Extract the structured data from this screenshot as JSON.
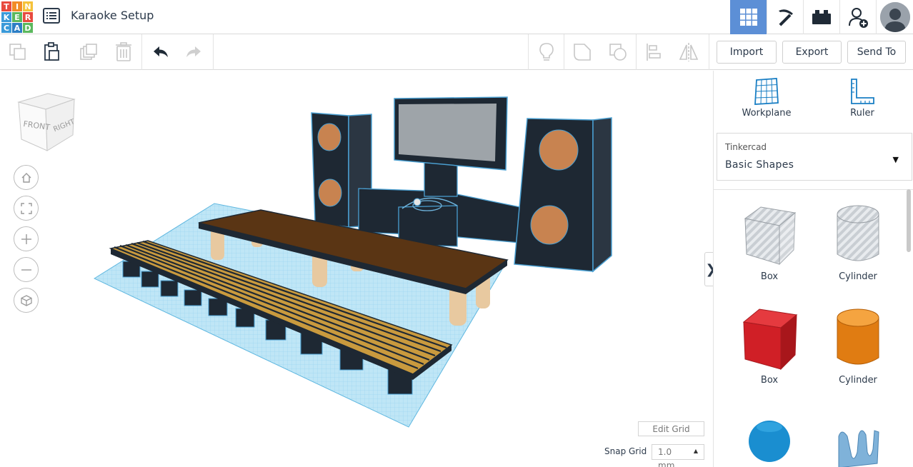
{
  "app": {
    "logo_letters": [
      "T",
      "I",
      "N",
      "K",
      "E",
      "R",
      "C",
      "A",
      "D"
    ],
    "logo_colors": [
      "#e84a3e",
      "#f28c28",
      "#f5c23a",
      "#3a9ad9",
      "#5bb85d",
      "#e84a3e",
      "#3a9ad9",
      "#2d7ec4",
      "#5bb85d"
    ],
    "title": "Karaoke Setup"
  },
  "topbar": {
    "icons": [
      "3d-design-grid-icon",
      "pickaxe-icon",
      "brick-icon",
      "add-user-icon"
    ],
    "active_color": "#5c8fd6"
  },
  "toolbar": {
    "import_label": "Import",
    "export_label": "Export",
    "send_to_label": "Send To"
  },
  "viewcube": {
    "front": "FRONT",
    "right": "RIGHT"
  },
  "grid": {
    "edit_grid_label": "Edit Grid",
    "snap_label": "Snap Grid",
    "snap_value": "1.0",
    "snap_unit": "mm"
  },
  "panel": {
    "workplane_label": "Workplane",
    "ruler_label": "Ruler",
    "library_source": "Tinkercad",
    "library_category": "Basic Shapes",
    "shapes": [
      {
        "label": "Box",
        "style": "hole"
      },
      {
        "label": "Cylinder",
        "style": "hole"
      },
      {
        "label": "Box",
        "style": "solid",
        "color": "#d8262d"
      },
      {
        "label": "Cylinder",
        "style": "solid",
        "color": "#e9831a"
      },
      {
        "label": "",
        "style": "solid",
        "color": "#1a8ed0"
      },
      {
        "label": "",
        "style": "solid",
        "color": "#7fb2d9"
      }
    ]
  }
}
